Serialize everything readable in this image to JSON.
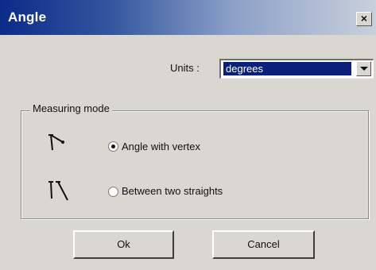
{
  "window": {
    "title": "Angle",
    "close_label": "×"
  },
  "units": {
    "label": "Units :",
    "selected": "degrees"
  },
  "measuring_mode": {
    "legend": "Measuring mode",
    "options": [
      {
        "label": "Angle with vertex",
        "checked": true,
        "icon": "angle-vertex-icon"
      },
      {
        "label": "Between two straights",
        "checked": false,
        "icon": "two-straights-icon"
      }
    ]
  },
  "buttons": {
    "ok_label": "Ok",
    "cancel_label": "Cancel"
  },
  "colors": {
    "titlebar_start": "#0c2a88",
    "titlebar_end": "#c9d0dc",
    "dialog_bg": "#d9d7d0",
    "selection_bg": "#0a1f7a"
  }
}
